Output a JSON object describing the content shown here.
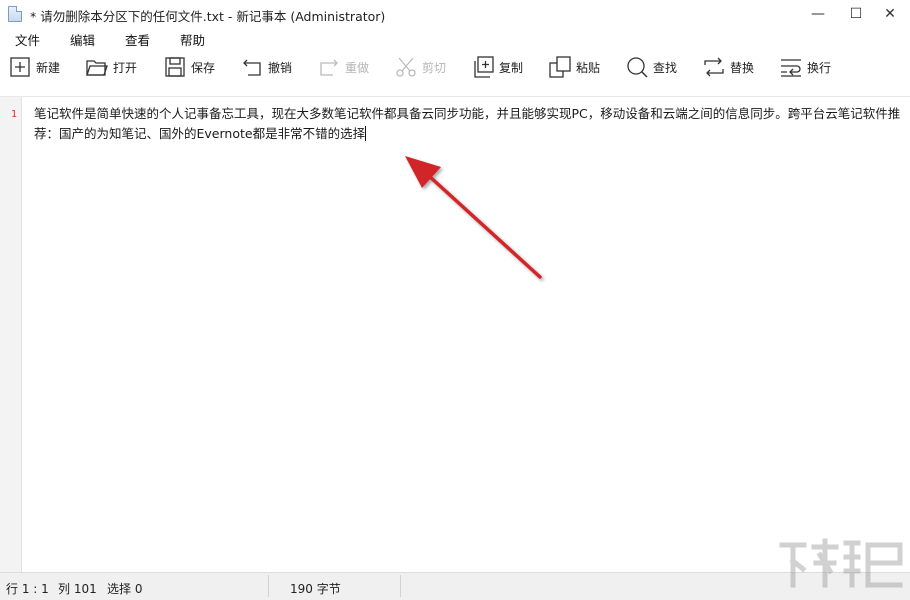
{
  "window": {
    "title": "* 请勿删除本分区下的任何文件.txt - 新记事本 (Administrator)",
    "controls": {
      "minimize": "—",
      "maximize": "☐",
      "close": "✕"
    }
  },
  "menu": {
    "items": [
      "文件",
      "编辑",
      "查看",
      "帮助"
    ]
  },
  "toolbar": {
    "new": "新建",
    "open": "打开",
    "save": "保存",
    "undo": "撤销",
    "redo": "重做",
    "cut": "剪切",
    "copy": "复制",
    "paste": "粘贴",
    "find": "查找",
    "replace": "替换",
    "wrap": "换行"
  },
  "editor": {
    "line_number": "1",
    "content": "笔记软件是简单快速的个人记事备忘工具，现在大多数笔记软件都具备云同步功能，并且能够实现PC，移动设备和云端之间的信息同步。跨平台云笔记软件推荐：国产的为知笔记、国外的Evernote都是非常不错的选择"
  },
  "status": {
    "position": "行 1 : 1",
    "column": "列 101",
    "selection": "选择 0",
    "bytes": "190 字节"
  },
  "colors": {
    "annotation_arrow": "#d0282c",
    "line_number": "#dd3333",
    "disabled_text": "#b5b5b5"
  },
  "icons": [
    "new-icon",
    "open-folder-icon",
    "save-icon",
    "undo-icon",
    "redo-icon",
    "cut-icon",
    "copy-icon",
    "paste-icon",
    "search-icon",
    "replace-icon",
    "wrap-icon"
  ]
}
